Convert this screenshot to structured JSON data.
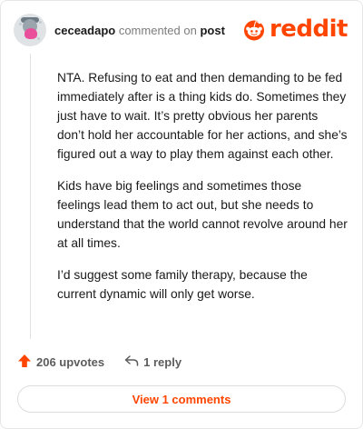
{
  "header": {
    "username": "ceceadapo",
    "action_text": "commented on",
    "post_link": "post"
  },
  "logo": {
    "wordmark": "reddit",
    "brand_color": "#ff4500"
  },
  "comment": {
    "paragraphs": [
      "NTA. Refusing to eat and then demanding to be fed immediately after is a thing kids do. Sometimes they just have to wait. It’s pretty obvious her parents don’t hold her accountable for her actions, and she’s figured out a way to play them against each other.",
      "Kids have big feelings and sometimes those feelings lead them to act out, but she needs to understand that the world cannot revolve around her at all times.",
      "I’d suggest some family therapy, because the current dynamic will only get worse."
    ]
  },
  "actions": {
    "upvotes": "206 upvotes",
    "replies": "1 reply",
    "upvote_icon": "upvote-arrow-icon",
    "reply_icon": "reply-icon",
    "upvote_color": "#ff4500"
  },
  "view_comments_button": "View 1 comments"
}
